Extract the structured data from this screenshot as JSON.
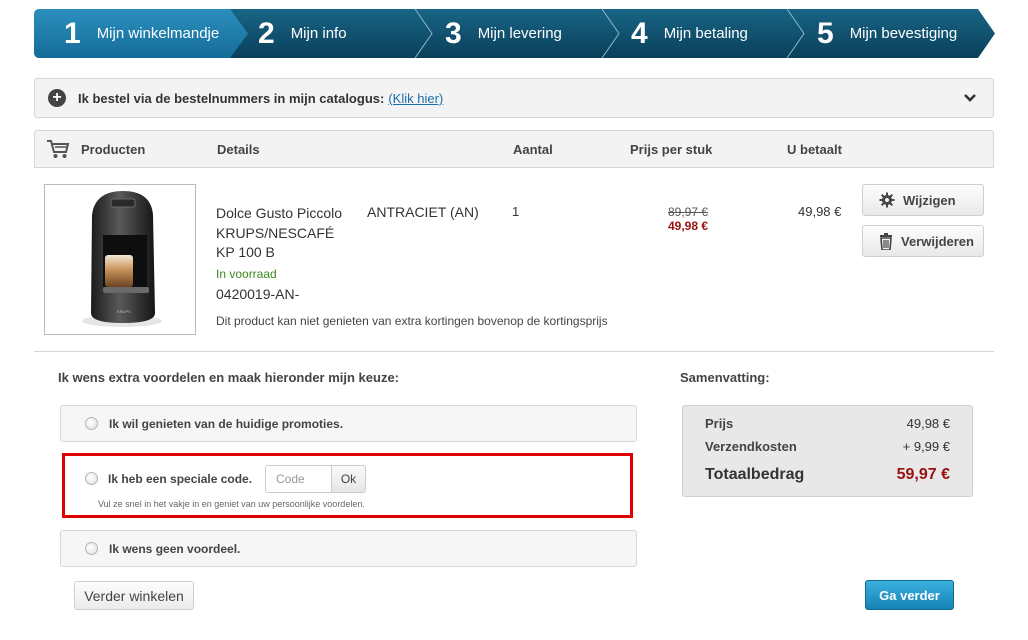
{
  "steps": [
    {
      "num": "1",
      "label": "Mijn winkelmandje",
      "active": true
    },
    {
      "num": "2",
      "label": "Mijn info",
      "active": false
    },
    {
      "num": "3",
      "label": "Mijn levering",
      "active": false
    },
    {
      "num": "4",
      "label": "Mijn betaling",
      "active": false
    },
    {
      "num": "5",
      "label": "Mijn bevestiging",
      "active": false
    }
  ],
  "catalog": {
    "text": "Ik bestel via de bestelnummers in mijn catalogus:",
    "link": "(Klik hier)",
    "icon": "plus-circle-icon",
    "toggle_icon": "chevron-down-icon"
  },
  "table": {
    "headers": {
      "products": "Producten",
      "details": "Details",
      "quantity": "Aantal",
      "unit_price": "Prijs per stuk",
      "you_pay": "U betaalt"
    },
    "cart_icon": "cart-icon"
  },
  "product": {
    "name_lines": [
      "Dolce Gusto Piccolo",
      "KRUPS/NESCAFÉ",
      "KP 100 B"
    ],
    "color": "ANTRACIET (AN)",
    "stock": "In voorraad",
    "sku": "0420019-AN-",
    "note": "Dit product kan niet genieten van extra kortingen bovenop de kortingsprijs",
    "quantity": "1",
    "old_price": "89,97 €",
    "new_price": "49,98 €",
    "total": "49,98 €",
    "edit_label": "Wijzigen",
    "remove_label": "Verwijderen"
  },
  "benefits": {
    "title": "Ik wens extra voordelen en maak hieronder mijn keuze:",
    "option_promotions": "Ik wil genieten van de huidige promoties.",
    "option_code": "Ik heb een speciale code.",
    "code_placeholder": "Code",
    "code_button": "Ok",
    "code_hint": "Vul ze snel in het vakje in en geniet van uw persoonlijke voordelen.",
    "option_none": "Ik wens geen voordeel."
  },
  "summary": {
    "title": "Samenvatting:",
    "price_label": "Prijs",
    "price_value": "49,98 €",
    "shipping_label": "Verzendkosten",
    "shipping_value": "+ 9,99 €",
    "total_label": "Totaalbedrag",
    "total_value": "59,97 €"
  },
  "buttons": {
    "continue_shopping": "Verder winkelen",
    "next": "Ga verder"
  },
  "colors": {
    "step_active": "#1b7aa6",
    "step_inactive": "#0d4f6e",
    "price_red": "#9a1010",
    "stock_green": "#3a8a1e",
    "highlight_border": "#e00000",
    "next_button": "#1e93c8"
  }
}
